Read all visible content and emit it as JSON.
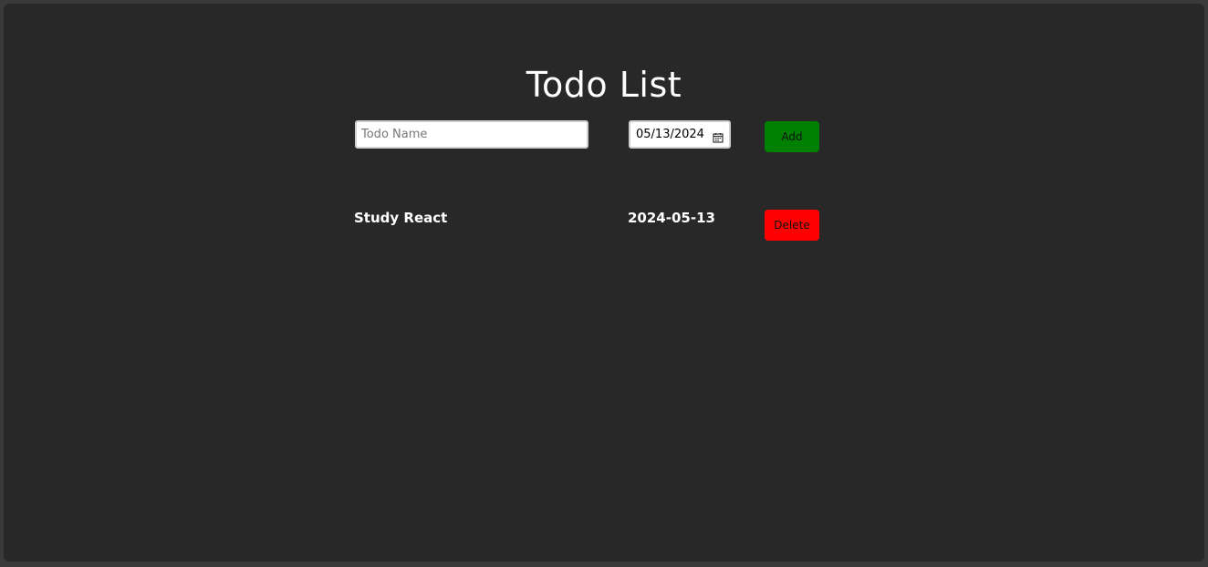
{
  "app": {
    "title": "Todo List"
  },
  "form": {
    "name_placeholder": "Todo Name",
    "name_value": "",
    "date_value": "05/13/2024",
    "add_label": "Add"
  },
  "todos": [
    {
      "name": "Study React",
      "date": "2024-05-13",
      "delete_label": "Delete"
    }
  ],
  "colors": {
    "background": "#282828",
    "add_button": "#008000",
    "delete_button": "#ff0000",
    "text": "#ffffff"
  },
  "icons": {
    "date_picker": "calendar-icon"
  }
}
